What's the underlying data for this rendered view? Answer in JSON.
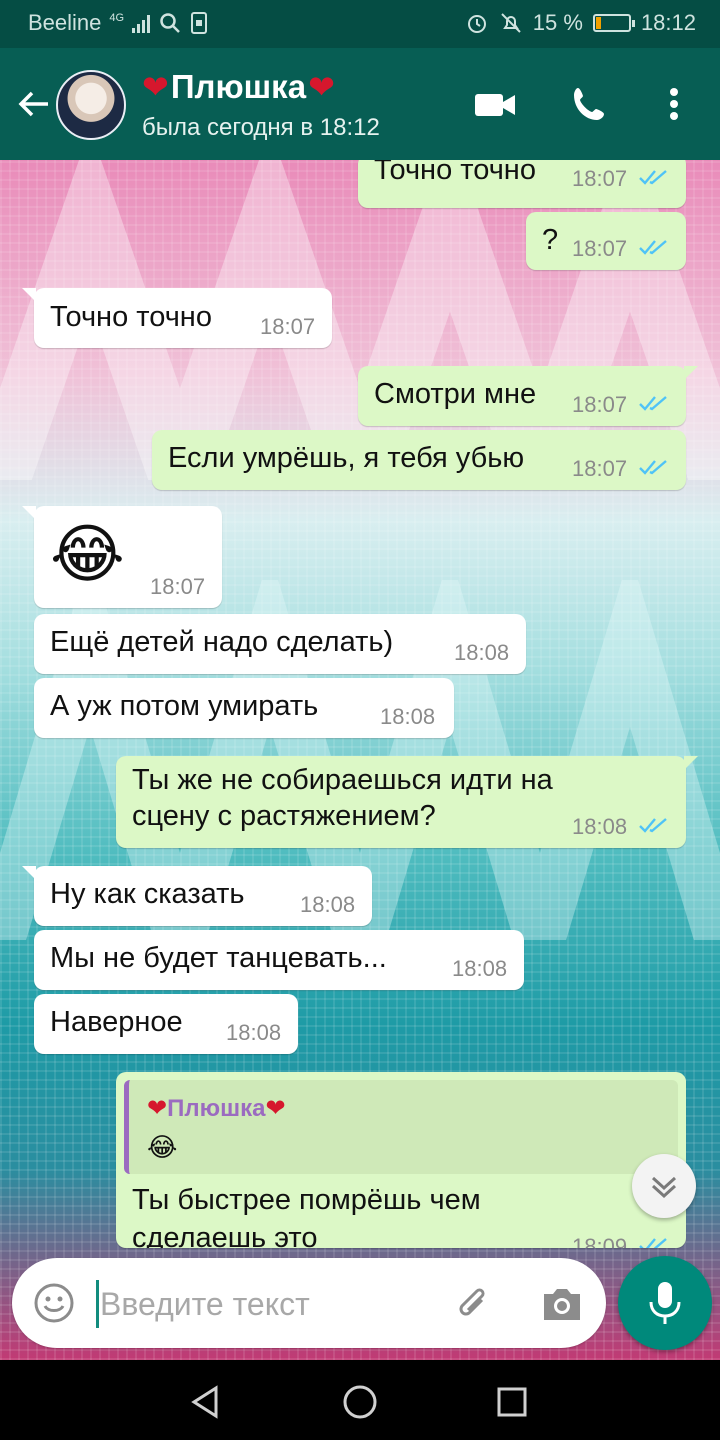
{
  "status_bar": {
    "carrier": "Beeline",
    "network": "4G",
    "battery": "15 %",
    "battery_level": 0.15,
    "time": "18:12",
    "icons": [
      "signal-icon",
      "search-icon",
      "sim-icon",
      "alarm-icon",
      "mute-icon",
      "battery-icon"
    ]
  },
  "header": {
    "contact_name": "Плюшка",
    "name_decoration": "heart-icon",
    "last_seen": "была сегодня в 18:12",
    "actions": [
      "back-icon",
      "video-call-icon",
      "phone-call-icon",
      "more-vert-icon"
    ]
  },
  "messages": [
    {
      "dir": "out",
      "text": "Точно точно",
      "time": "18:07",
      "status": "read"
    },
    {
      "dir": "out",
      "text": "?",
      "time": "18:07",
      "status": "read"
    },
    {
      "dir": "in",
      "text": "Точно точно",
      "time": "18:07"
    },
    {
      "dir": "out",
      "text": "Смотри мне",
      "time": "18:07",
      "status": "read"
    },
    {
      "dir": "out",
      "text": "Если умрёшь, я тебя убью",
      "time": "18:07",
      "status": "read"
    },
    {
      "dir": "in",
      "text": "😂",
      "time": "18:07"
    },
    {
      "dir": "in",
      "text": "Ещё детей надо сделать)",
      "time": "18:08"
    },
    {
      "dir": "in",
      "text": "А уж потом умирать",
      "time": "18:08"
    },
    {
      "dir": "out",
      "text_line1": "Ты же не собираешься идти на",
      "text_line2": "сцену с растяжением?",
      "time": "18:08",
      "status": "read"
    },
    {
      "dir": "in",
      "text": "Ну как сказать",
      "time": "18:08"
    },
    {
      "dir": "in",
      "text": "Мы не будет танцевать...",
      "time": "18:08"
    },
    {
      "dir": "in",
      "text": "Наверное",
      "time": "18:08"
    },
    {
      "dir": "out",
      "quote_author": "Плюшка",
      "quote_text": "😂",
      "text_line1": "Ты быстрее помрёшь чем",
      "text_line2": "сделаешь это",
      "time": "18:09",
      "status": "read"
    }
  ],
  "input": {
    "placeholder": "Введите текст",
    "icons": [
      "emoji-icon",
      "attach-icon",
      "camera-icon",
      "mic-icon"
    ]
  },
  "colors": {
    "header": "#075e54",
    "status_bar": "#054d44",
    "bubble_in": "#ffffff",
    "bubble_out": "#dcf8c6",
    "read_ticks": "#4fc3f7",
    "accent": "#00897b"
  }
}
